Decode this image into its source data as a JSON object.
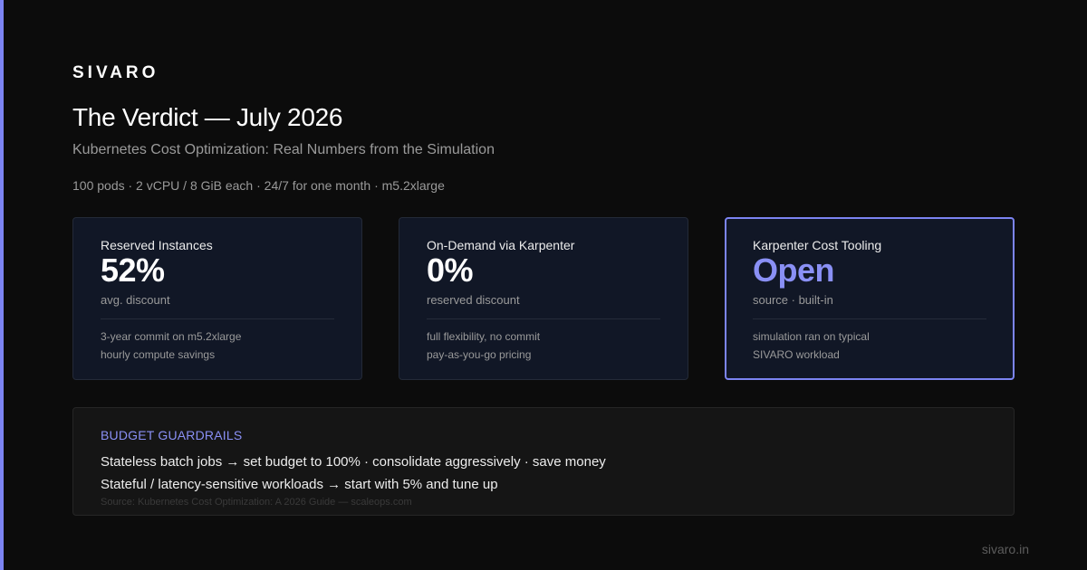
{
  "brand": "SIVARO",
  "title": "The Verdict — July 2026",
  "subtitle": "Kubernetes Cost Optimization: Real Numbers from the Simulation",
  "specs": "100 pods · 2 vCPU / 8 GiB each · 24/7 for one month · m5.2xlarge",
  "cards": [
    {
      "label": "Reserved Instances",
      "value": "52%",
      "unit": "avg. discount",
      "notes": [
        "3-year commit on m5.2xlarge",
        "hourly compute savings"
      ]
    },
    {
      "label": "On-Demand via Karpenter",
      "value": "0%",
      "unit": "reserved discount",
      "notes": [
        "full flexibility, no commit",
        "pay-as-you-go pricing"
      ]
    },
    {
      "label": "Karpenter Cost Tooling",
      "value": "Open",
      "unit": "source · built-in",
      "notes": [
        "simulation ran on typical",
        "SIVARO workload"
      ]
    }
  ],
  "guardrails": {
    "title": "BUDGET GUARDRAILS",
    "lines": [
      "Stateless batch jobs → set budget to 100% · consolidate aggressively · save money",
      "Stateful / latency-sensitive workloads → start with 5% and tune up"
    ],
    "source": "Source: Kubernetes Cost Optimization: A 2026 Guide — scaleops.com"
  },
  "footer_url": "sivaro.in",
  "colors": {
    "background": "#0c0c0c",
    "accent": "#7c84f2",
    "card_bg": "#111726",
    "muted_text": "#9a9a9a"
  }
}
